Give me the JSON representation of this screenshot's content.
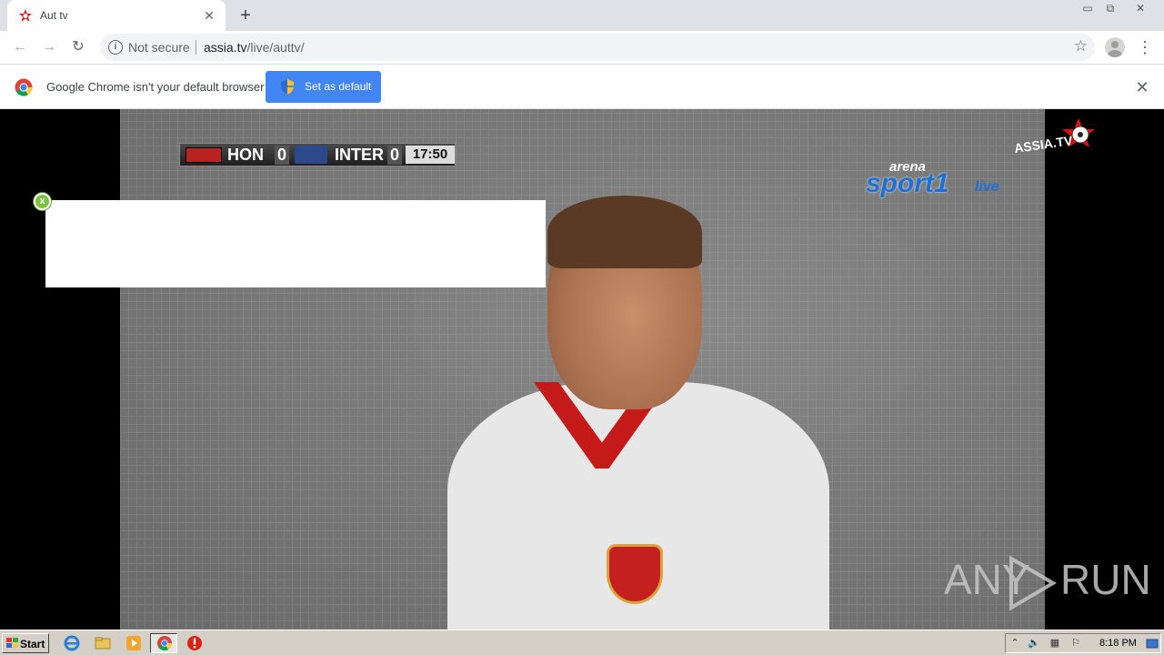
{
  "browser": {
    "tab": {
      "title": "Aut tv",
      "close_glyph": "✕",
      "favicon": "assia-star-icon"
    },
    "new_tab_glyph": "+",
    "window_controls": {
      "minimize": "▭",
      "restore": "⧉",
      "close": "✕"
    },
    "nav": {
      "back": "←",
      "forward": "→",
      "reload": "↻"
    },
    "omnibox": {
      "security_label": "Not secure",
      "url_host": "assia.tv",
      "url_path": "/live/auttv/"
    },
    "bookmark_glyph": "☆",
    "menu_glyph": "⋮"
  },
  "infobar": {
    "message": "Google Chrome isn't your default browser",
    "button_label": "Set as default",
    "close_glyph": "✕"
  },
  "video": {
    "scoreboard": {
      "team1": "HON",
      "score1": "0",
      "team2": "INTER",
      "score2": "0",
      "clock": "17:50"
    },
    "channel": {
      "line1": "arena",
      "line2": "sport1",
      "line3": "live"
    },
    "watermark": "ASSIA.TV"
  },
  "ad": {
    "close_glyph": "x"
  },
  "overlay_watermark": {
    "left": "ANY",
    "right": "RUN"
  },
  "taskbar": {
    "start_label": "Start",
    "clock": "8:18 PM"
  },
  "colors": {
    "accent": "#4285f4",
    "tabstrip": "#dee1e6",
    "taskbar": "#d4d0c8"
  }
}
